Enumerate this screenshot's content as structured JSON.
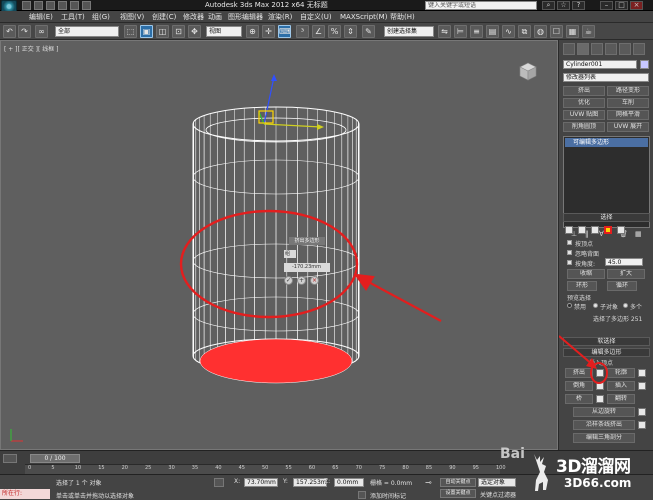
{
  "titlebar": {
    "title": "Autodesk 3ds Max  2012 x64     无标题",
    "search_placeholder": "键入关键字或短语"
  },
  "menu": {
    "items": [
      "编辑(E)",
      "工具(T)",
      "组(G)",
      "视图(V)",
      "创建(C)",
      "修改器",
      "动画",
      "图形编辑器",
      "渲染(R)",
      "自定义(U)",
      "MAXScript(M)",
      "帮助(H)"
    ]
  },
  "toolbar": {
    "filter_value": "全部",
    "ref_coord_value": "视图",
    "named_sel_value": "创建选择集"
  },
  "viewport": {
    "label": "[ + ][ 正交 ][ 线框 ]",
    "caddy_title": "挤出多边形",
    "caddy_type": "组",
    "caddy_amount": "-170.23mm"
  },
  "command_panel": {
    "object_name": "Cylinder001",
    "modifier_list": "修改器列表",
    "buttons": [
      "挤出",
      "路径变形",
      "优化",
      "车削",
      "UVW 贴图",
      "网格平滑",
      "削角圆顶",
      "UVW 展开"
    ],
    "stack_item": "可编辑多边形",
    "selection_title": "选择",
    "by_vertex": "按顶点",
    "ignore_backfacing": "忽略背面",
    "by_angle": "按角度:",
    "by_angle_value": "45.0",
    "shrink": "收缩",
    "grow": "扩大",
    "ring": "环形",
    "loop": "循环",
    "preview_selection": "预览选择",
    "disabled": "禁用",
    "sub_object": "子对象",
    "multi": "多个",
    "selected_count": "选择了多边形 251",
    "soft_selection": "软选择",
    "edit_polygons": "编辑多边形",
    "insert_vertex": "插入顶点",
    "extrude": "挤出",
    "outline": "轮廓",
    "bevel": "倒角",
    "inset": "插入",
    "bridge": "桥",
    "flip": "翻转",
    "hinge_from_edge": "从边旋转",
    "extrude_along_spline": "沿样条线挤出",
    "edit_triangulation": "编辑三角剖分"
  },
  "timeline": {
    "slider": "0 / 100",
    "ticks": [
      "0",
      "5",
      "10",
      "15",
      "20",
      "25",
      "30",
      "35",
      "40",
      "45",
      "50",
      "55",
      "60",
      "65",
      "70",
      "75",
      "80",
      "85",
      "90",
      "95",
      "100"
    ]
  },
  "status": {
    "maxscript_label": "所在行:",
    "message_top": "选择了 1 个 对象",
    "message_bottom": "单击或单击并拖动以选择对象",
    "x_label": "X:",
    "x_value": "73.70mm",
    "y_label": "Y:",
    "y_value": "157.253m",
    "z_label": "Z:",
    "z_value": "0.0mm",
    "grid": "栅格 = 0.0mm",
    "auto_key": "自动关键点",
    "selected_dropdown": "选定对象",
    "set_key": "设置关键点",
    "key_filters": "关键点过滤器",
    "add_time_tag": "添加时间标记"
  },
  "watermark": {
    "text": "3D溜溜网",
    "url": "3D66.com",
    "partial": "Bai"
  },
  "colors": {
    "annotation_red": "#e31e1e",
    "selection_fill": "#ff3030",
    "wireframe": "#ffffff",
    "highlight_yellow": "#ffd400"
  }
}
